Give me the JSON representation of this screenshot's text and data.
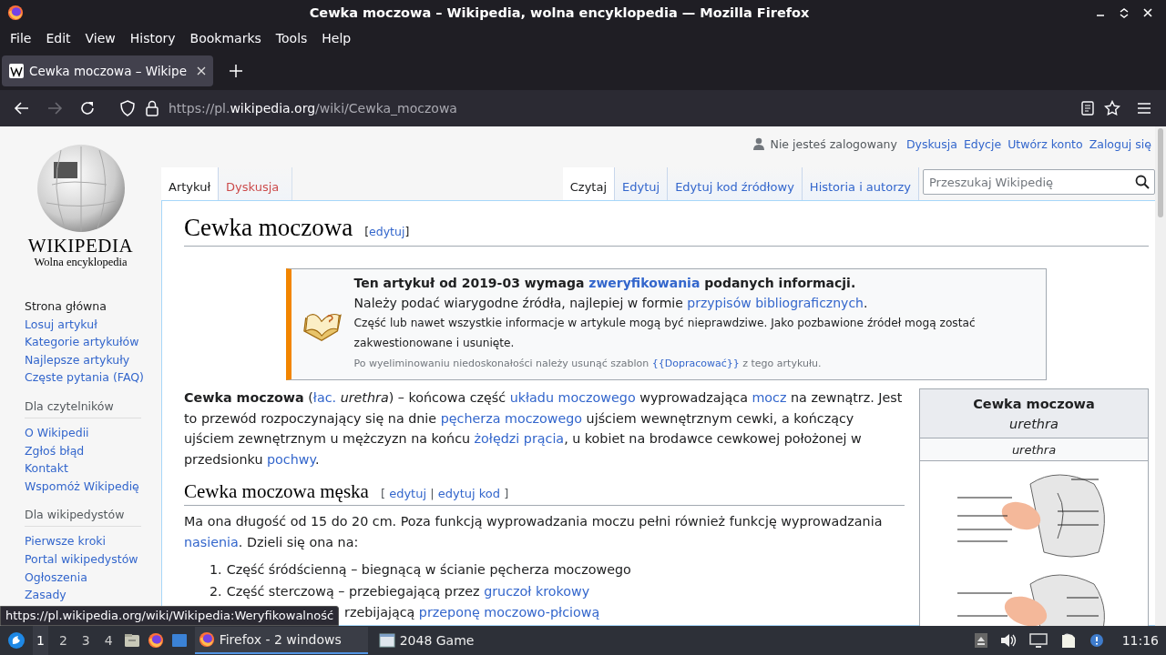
{
  "window": {
    "title": "Cewka moczowa – Wikipedia, wolna encyklopedia — Mozilla Firefox"
  },
  "menu": [
    "File",
    "Edit",
    "View",
    "History",
    "Bookmarks",
    "Tools",
    "Help"
  ],
  "tabs": [
    {
      "label": "Cewka moczowa – Wikipe",
      "selected": true
    }
  ],
  "url": {
    "prefix": "https://pl.",
    "domain": "wikipedia.org",
    "path": "/wiki/Cewka_moczowa"
  },
  "sidebar": {
    "logo_title": "WIKIPEDIA",
    "logo_subtitle": "Wolna encyklopedia",
    "nav": [
      "Strona główna",
      "Losuj artykuł",
      "Kategorie artykułów",
      "Najlepsze artykuły",
      "Częste pytania (FAQ)"
    ],
    "sections": [
      {
        "heading": "Dla czytelników",
        "items": [
          "O Wikipedii",
          "Zgłoś błąd",
          "Kontakt",
          "Wspomóż Wikipedię"
        ]
      },
      {
        "heading": "Dla wikipedystów",
        "items": [
          "Pierwsze kroki",
          "Portal wikipedystów",
          "Ogłoszenia",
          "Zasady"
        ]
      }
    ]
  },
  "personal": {
    "status": "Nie jesteś zalogowany",
    "links": [
      "Dyskusja",
      "Edycje",
      "Utwórz konto",
      "Zaloguj się"
    ]
  },
  "page_tabs": [
    {
      "label": "Artykuł",
      "selected": true,
      "missing": false
    },
    {
      "label": "Dyskusja",
      "selected": false,
      "missing": true
    }
  ],
  "view_tabs": [
    {
      "label": "Czytaj",
      "selected": true
    },
    {
      "label": "Edytuj",
      "selected": false
    },
    {
      "label": "Edytuj kod źródłowy",
      "selected": false
    },
    {
      "label": "Historia i autorzy",
      "selected": false
    }
  ],
  "search": {
    "placeholder": "Przeszukaj Wikipedię"
  },
  "article": {
    "title": "Cewka moczowa",
    "title_edit": [
      {
        "kind": "text",
        "text": "["
      },
      {
        "kind": "link",
        "text": "edytuj"
      },
      {
        "kind": "text",
        "text": "]"
      }
    ],
    "notice": {
      "heading": [
        {
          "kind": "text",
          "text": "Ten artykuł od 2019-03 wymaga "
        },
        {
          "kind": "link",
          "text": "zweryfikowania"
        },
        {
          "kind": "text",
          "text": " podanych informacji."
        }
      ],
      "line": [
        {
          "kind": "text",
          "text": "Należy podać wiarygodne źródła, najlepiej w formie "
        },
        {
          "kind": "link",
          "text": "przypisów bibliograficznych"
        },
        {
          "kind": "text",
          "text": "."
        }
      ],
      "warning": "Część lub nawet wszystkie informacje w artykule mogą być nieprawdziwe. Jako pozbawione źródeł mogą zostać zakwestionowane i usunięte.",
      "footnote": [
        {
          "kind": "text",
          "text": "Po wyeliminowaniu niedoskonałości należy usunąć szablon "
        },
        {
          "kind": "link",
          "text": "{{Dopracować}}"
        },
        {
          "kind": "text",
          "text": " z tego artykułu."
        }
      ]
    },
    "infobox": {
      "title": "Cewka moczowa",
      "subtitle": "urethra",
      "caption": "urethra"
    },
    "lead": [
      {
        "kind": "bold",
        "text": "Cewka moczowa"
      },
      {
        "kind": "text",
        "text": " ("
      },
      {
        "kind": "link",
        "text": "łac."
      },
      {
        "kind": "italic",
        "text": " urethra"
      },
      {
        "kind": "text",
        "text": ") – końcowa część "
      },
      {
        "kind": "link",
        "text": "układu moczowego"
      },
      {
        "kind": "text",
        "text": " wyprowadzająca "
      },
      {
        "kind": "link",
        "text": "mocz"
      },
      {
        "kind": "text",
        "text": " na zewnątrz. Jest to przewód rozpoczynający się na dnie "
      },
      {
        "kind": "link",
        "text": "pęcherza moczowego"
      },
      {
        "kind": "text",
        "text": " ujściem wewnętrznym cewki, a kończący ujściem zewnętrznym u mężczyzn na końcu "
      },
      {
        "kind": "link",
        "text": "żołędzi prącia"
      },
      {
        "kind": "text",
        "text": ", u kobiet na brodawce cewkowej położonej w przedsionku "
      },
      {
        "kind": "link",
        "text": "pochwy"
      },
      {
        "kind": "text",
        "text": "."
      }
    ],
    "section": {
      "heading": "Cewka moczowa męska",
      "edit": [
        {
          "kind": "text",
          "text": "[ "
        },
        {
          "kind": "link",
          "text": "edytuj"
        },
        {
          "kind": "text",
          "text": " | "
        },
        {
          "kind": "link",
          "text": "edytuj kod"
        },
        {
          "kind": "text",
          "text": " ]"
        }
      ],
      "paragraph": [
        {
          "kind": "text",
          "text": "Ma ona długość od 15 do 20 cm. Poza funkcją wyprowadzania moczu pełni również funkcję wyprowadzania "
        },
        {
          "kind": "link",
          "text": "nasienia"
        },
        {
          "kind": "text",
          "text": ". Dzieli się ona na:"
        }
      ],
      "list": [
        {
          "number": "1.",
          "segments": [
            {
              "kind": "text",
              "text": "Część śródścienną – biegnącą w ścianie pęcherza moczowego"
            }
          ]
        },
        {
          "number": "2.",
          "segments": [
            {
              "kind": "text",
              "text": "Część sterczową – przebiegającą przez "
            },
            {
              "kind": "link",
              "text": "gruczoł krokowy"
            }
          ]
        },
        {
          "segments": [
            {
              "kind": "text",
              "text": "rzebijającą "
            },
            {
              "kind": "link",
              "text": "przeponę moczowo-płciową"
            }
          ]
        }
      ]
    }
  },
  "status_url": "https://pl.wikipedia.org/wiki/Wikipedia:Weryfikowalność",
  "taskbar": {
    "workspaces": [
      {
        "label": "1",
        "selected": true
      },
      {
        "label": "2",
        "selected": false
      },
      {
        "label": "3",
        "selected": false
      },
      {
        "label": "4",
        "selected": false
      }
    ],
    "tasks": [
      {
        "label": "Firefox - 2 windows",
        "selected": true,
        "kind": "firefox"
      },
      {
        "label": "2048 Game",
        "selected": false,
        "kind": "window"
      }
    ],
    "clock": "11:16"
  }
}
